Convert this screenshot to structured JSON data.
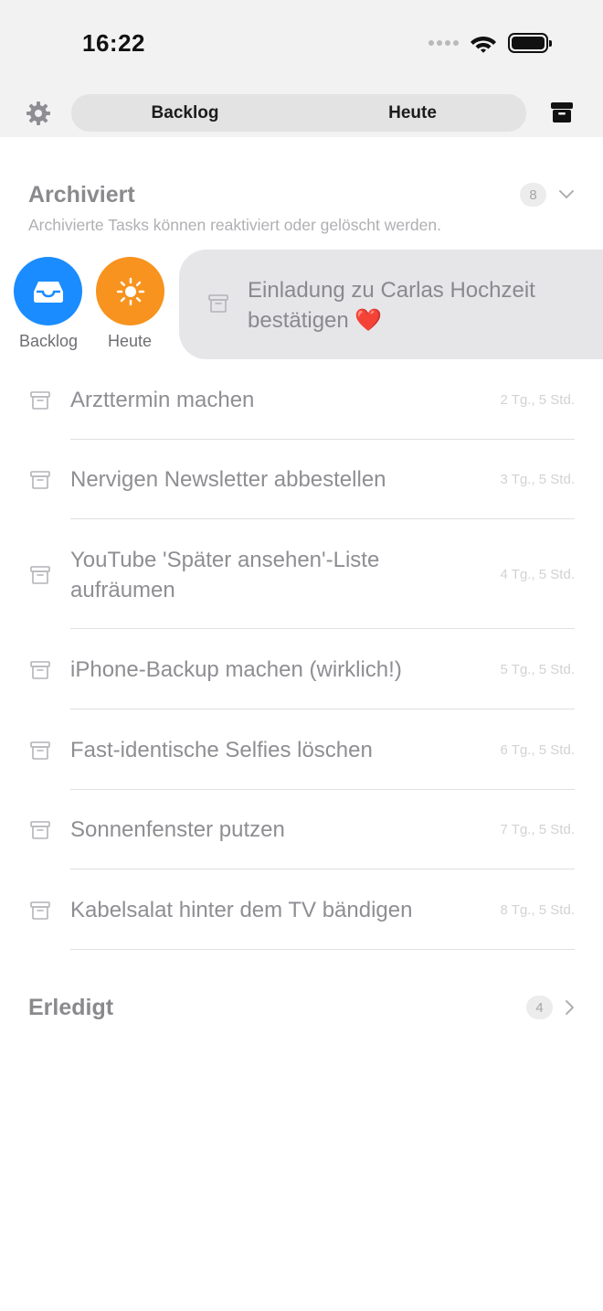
{
  "status_bar": {
    "time": "16:22"
  },
  "header": {
    "tabs": [
      {
        "label": "Backlog"
      },
      {
        "label": "Heute"
      }
    ]
  },
  "archived": {
    "title": "Archiviert",
    "subtitle": "Archivierte Tasks können reaktiviert oder gelöscht werden.",
    "count": "8"
  },
  "swipe_actions": [
    {
      "label": "Backlog",
      "color": "#1a8cff",
      "icon": "tray-icon"
    },
    {
      "label": "Heute",
      "color": "#f7931e",
      "icon": "sun-icon"
    }
  ],
  "swiped_item": {
    "title": "Einladung zu Carlas Hochzeit bestätigen ❤️"
  },
  "items": [
    {
      "title": "Arzttermin machen",
      "age": "2 Tg., 5 Std."
    },
    {
      "title": "Nervigen Newsletter abbestellen",
      "age": "3 Tg., 5 Std."
    },
    {
      "title": "YouTube 'Später ansehen'-Liste aufräumen",
      "age": "4 Tg., 5 Std."
    },
    {
      "title": "iPhone-Backup machen (wirklich!)",
      "age": "5 Tg., 5 Std."
    },
    {
      "title": "Fast-identische Selfies löschen",
      "age": "6 Tg., 5 Std."
    },
    {
      "title": "Sonnenfenster putzen",
      "age": "7 Tg., 5 Std."
    },
    {
      "title": "Kabelsalat hinter dem TV bändigen",
      "age": "8 Tg., 5 Std."
    }
  ],
  "done": {
    "title": "Erledigt",
    "count": "4"
  }
}
